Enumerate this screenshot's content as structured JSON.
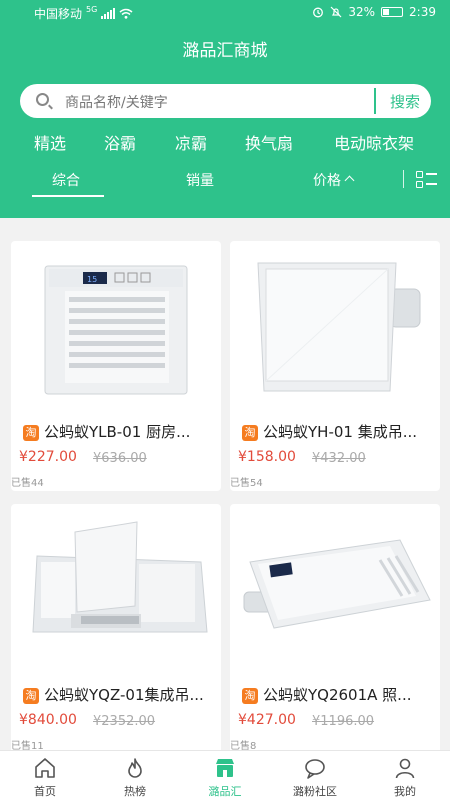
{
  "status": {
    "carrier": "中国移动",
    "network": "5G",
    "battery": "32%",
    "time": "2:39"
  },
  "title": "潞品汇商城",
  "search": {
    "placeholder": "商品名称/关键字",
    "button": "搜索"
  },
  "categories": [
    "精选",
    "浴霸",
    "凉霸",
    "换气扇",
    "电动晾衣架"
  ],
  "sorts": {
    "comprehensive": "综合",
    "sales": "销量",
    "price": "价格"
  },
  "products": [
    {
      "name": "公蚂蚁YLB-01 厨房...",
      "price": "¥227.00",
      "old_price": "¥636.00",
      "sold": "已售44",
      "badge": "淘",
      "display": "15"
    },
    {
      "name": "公蚂蚁YH-01 集成吊...",
      "price": "¥158.00",
      "old_price": "¥432.00",
      "sold": "已售54",
      "badge": "淘"
    },
    {
      "name": "公蚂蚁YQZ-01集成吊...",
      "price": "¥840.00",
      "old_price": "¥2352.00",
      "sold": "已售11",
      "badge": "淘"
    },
    {
      "name": "公蚂蚁YQ2601A 照...",
      "price": "¥427.00",
      "old_price": "¥1196.00",
      "sold": "已售8",
      "badge": "淘"
    }
  ],
  "tabs": [
    {
      "label": "首页",
      "icon": "home-icon"
    },
    {
      "label": "热榜",
      "icon": "flame-icon"
    },
    {
      "label": "潞品汇",
      "icon": "store-icon",
      "active": true
    },
    {
      "label": "潞粉社区",
      "icon": "chat-icon"
    },
    {
      "label": "我的",
      "icon": "user-icon"
    }
  ],
  "colors": {
    "brand": "#2ec28b",
    "price": "#e24b3b",
    "badge": "#f57c20"
  }
}
